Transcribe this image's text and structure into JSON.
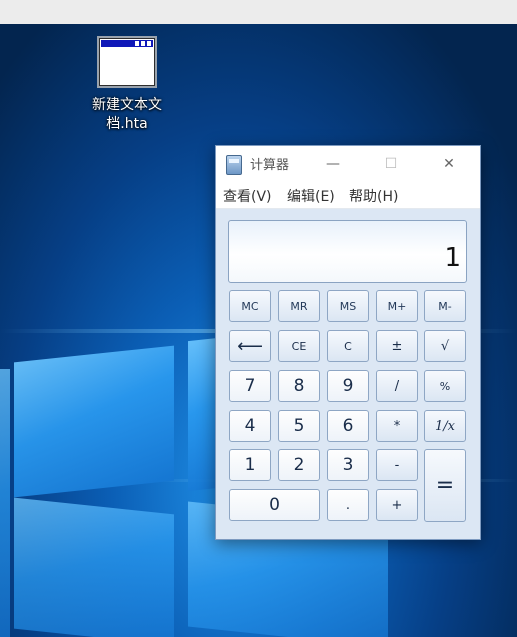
{
  "desktop": {
    "icon_label": "新建文本文档.hta"
  },
  "window": {
    "title": "计算器",
    "minimize_glyph": "—",
    "maximize_glyph": "☐",
    "close_glyph": "✕"
  },
  "menu": {
    "view": "查看(V)",
    "edit": "编辑(E)",
    "help": "帮助(H)"
  },
  "display": {
    "value": "1"
  },
  "keys": {
    "mc": "MC",
    "mr": "MR",
    "ms": "MS",
    "mplus": "M+",
    "mminus": "M-",
    "backspace": "⟵",
    "ce": "CE",
    "c": "C",
    "plusminus": "±",
    "sqrt": "√",
    "seven": "7",
    "eight": "8",
    "nine": "9",
    "divide": "/",
    "percent": "%",
    "four": "4",
    "five": "5",
    "six": "6",
    "multiply": "*",
    "reciprocal": "1/x",
    "one": "1",
    "two": "2",
    "three": "3",
    "minus": "-",
    "equals": "=",
    "zero": "0",
    "dot": ".",
    "plus": "+"
  },
  "colors": {
    "desktop_blue": "#0b5fb6",
    "calc_body": "#dce7f4",
    "key_border": "#8ea6c4"
  }
}
